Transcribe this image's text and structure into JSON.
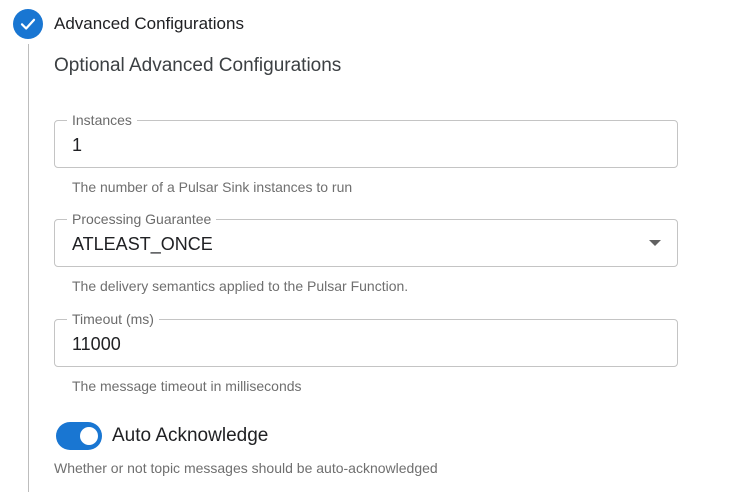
{
  "step": {
    "title": "Advanced Configurations",
    "status_icon": "check-icon",
    "accent_color": "#1976d2"
  },
  "section": {
    "title": "Optional Advanced Configurations"
  },
  "fields": {
    "instances": {
      "label": "Instances",
      "value": "1",
      "helper": "The number of a Pulsar Sink instances to run"
    },
    "processing_guarantee": {
      "label": "Processing Guarantee",
      "value": "ATLEAST_ONCE",
      "helper": "The delivery semantics applied to the Pulsar Function."
    },
    "timeout": {
      "label": "Timeout (ms)",
      "value": "11000",
      "helper": "The message timeout in milliseconds"
    }
  },
  "auto_acknowledge": {
    "label": "Auto Acknowledge",
    "enabled": true,
    "helper": "Whether or not topic messages should be auto-acknowledged"
  }
}
